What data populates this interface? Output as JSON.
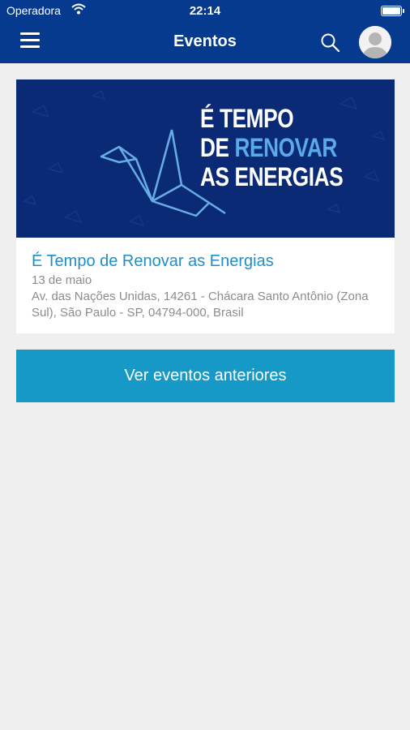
{
  "status_bar": {
    "carrier": "Operadora",
    "time": "22:14"
  },
  "header": {
    "title": "Eventos",
    "icons": [
      "menu-icon",
      "search-icon",
      "avatar-icon"
    ]
  },
  "event": {
    "banner": {
      "line1": "É TEMPO",
      "line2_prefix": "DE ",
      "line2_accent": "RENOVAR",
      "line3": "AS ENERGIAS"
    },
    "title": "É Tempo de Renovar as Energias",
    "date": "13 de maio",
    "address": "Av. das Nações Unidas, 14261 - Chácara Santo Antônio (Zona Sul), São Paulo - SP, 04794-000, Brasil"
  },
  "actions": {
    "previous_events": "Ver eventos anteriores"
  },
  "colors": {
    "header_bg": "#053a8e",
    "banner_bg": "#0b2a76",
    "accent": "#5aa9e8",
    "title_link": "#1f8fc7",
    "button_bg": "#1799c8",
    "page_bg": "#efefef"
  }
}
